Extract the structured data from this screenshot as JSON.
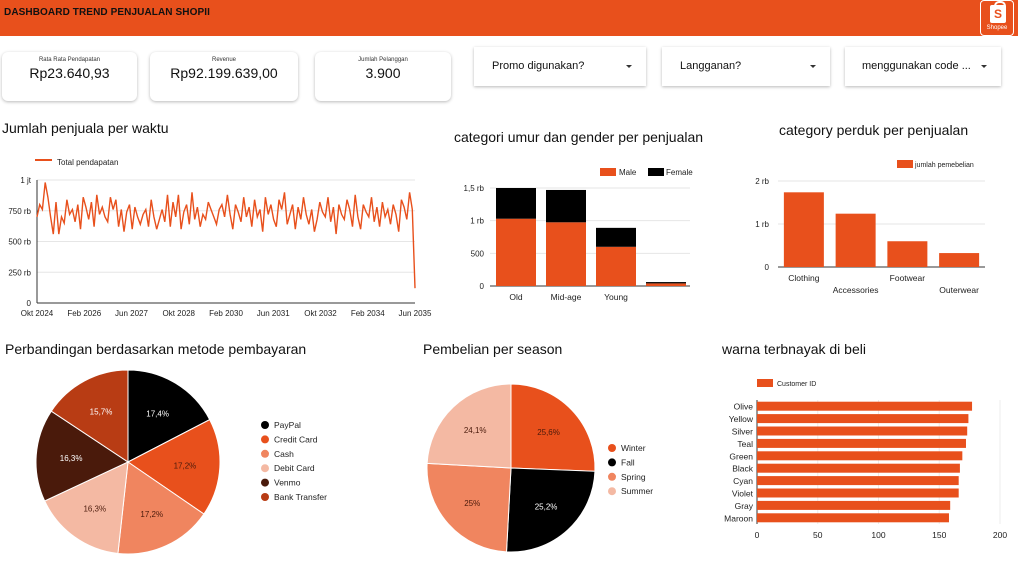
{
  "header": {
    "title": "DASHBOARD TREND PENJUALAN SHOPII",
    "logo_text": "S",
    "logo_label": "Shopee",
    "logo_icon": "shopee-bag-icon"
  },
  "kpis": [
    {
      "label": "Rata Rata Pendapatan",
      "value": "Rp23.640,93"
    },
    {
      "label": "Revenue",
      "value": "Rp92.199.639,00"
    },
    {
      "label": "Jumlah Pelanggan",
      "value": "3.900"
    }
  ],
  "filters": [
    {
      "label": "Promo digunakan?"
    },
    {
      "label": "Langganan?"
    },
    {
      "label": "menggunakan code ..."
    }
  ],
  "colors": {
    "accent": "#e8501c",
    "black": "#000000",
    "dark_brown": "#4a1a0b",
    "brown": "#b83c14",
    "salmon": "#f0855f",
    "light_salmon": "#f4b9a3"
  },
  "titles": {
    "line": "Jumlah penjuala per waktu",
    "stacked": "categori umur dan gender per penjualan",
    "category": "category perduk per penjualan",
    "payment": "Perbandingan berdasarkan metode pembayaran",
    "season": "Pembelian per season",
    "color": "warna terbnayak di beli"
  },
  "chart_data": [
    {
      "type": "line",
      "title": "Jumlah penjuala per waktu",
      "series": [
        {
          "name": "Total pendapatan",
          "values": [
            700,
            800,
            760,
            980,
            860,
            700,
            560,
            820,
            560,
            700,
            650,
            840,
            720,
            760,
            660,
            800,
            600,
            860,
            780,
            680,
            820,
            620,
            880,
            720,
            780,
            700,
            660,
            860,
            760,
            840,
            620,
            760,
            580,
            740,
            800,
            600,
            780,
            700,
            640,
            720,
            760,
            620,
            840,
            700,
            600,
            680,
            760,
            660,
            880,
            620,
            820,
            700,
            880,
            600,
            740,
            800,
            640,
            900,
            680,
            780,
            620,
            720,
            680,
            820,
            760,
            700,
            640,
            760,
            800,
            700,
            880,
            720,
            600,
            800,
            740,
            660,
            860,
            700,
            780,
            620,
            840,
            700,
            760,
            580,
            860,
            720,
            800,
            680,
            620,
            840,
            760,
            900,
            640,
            720,
            800,
            600,
            780,
            680,
            860,
            720,
            640,
            760,
            580,
            680,
            820,
            740,
            700,
            860,
            660,
            780,
            560,
            800,
            720,
            680,
            840,
            760,
            620,
            880,
            700,
            600,
            800,
            740,
            700,
            860,
            660,
            780,
            620,
            820,
            700,
            760,
            640,
            800,
            720,
            580,
            840,
            780,
            680,
            900,
            760,
            120
          ]
        }
      ],
      "x_ticks": [
        "Okt 2024",
        "Feb 2026",
        "Jun 2027",
        "Okt 2028",
        "Feb 2030",
        "Jun 2031",
        "Okt 2032",
        "Feb 2034",
        "Jun 2035"
      ],
      "y_ticks": [
        "0",
        "250 rb",
        "500 rb",
        "750 rb",
        "1 jt"
      ],
      "ylim": [
        0,
        1000000
      ],
      "legend": "top-left"
    },
    {
      "type": "bar",
      "stacked": true,
      "title": "categori umur dan gender per penjualan",
      "categories": [
        "Old",
        "Mid-age",
        "Young",
        ""
      ],
      "series": [
        {
          "name": "Male",
          "values": [
            1030,
            975,
            600,
            40
          ]
        },
        {
          "name": "Female",
          "values": [
            470,
            495,
            290,
            20
          ]
        }
      ],
      "y_ticks": [
        "0",
        "500",
        "1 rb",
        "1,5 rb"
      ],
      "ylim": [
        0,
        1500
      ],
      "legend": "top-right"
    },
    {
      "type": "bar",
      "title": "category perduk per penjualan",
      "categories": [
        "Clothing",
        "Accessories",
        "Footwear",
        "Outerwear"
      ],
      "series": [
        {
          "name": "jumlah pemebelian",
          "values": [
            1737,
            1240,
            599,
            324
          ]
        }
      ],
      "y_ticks": [
        "0",
        "1 rb",
        "2 rb"
      ],
      "ylim": [
        0,
        2000
      ],
      "legend": "top-right"
    },
    {
      "type": "pie",
      "title": "Perbandingan berdasarkan metode pembayaran",
      "categories": [
        "PayPal",
        "Credit Card",
        "Cash",
        "Debit Card",
        "Venmo",
        "Bank Transfer"
      ],
      "values": [
        17.4,
        17.2,
        17.2,
        16.3,
        16.3,
        15.7
      ],
      "labels": [
        "17,4%",
        "17,2%",
        "17,2%",
        "16,3%",
        "16,3%",
        "15,7%"
      ],
      "legend": "right"
    },
    {
      "type": "pie",
      "title": "Pembelian per season",
      "categories": [
        "Winter",
        "Fall",
        "Spring",
        "Summer"
      ],
      "values": [
        25.6,
        25.2,
        25,
        24.1
      ],
      "labels": [
        "25,6%",
        "25,2%",
        "25%",
        "24,1%"
      ],
      "legend": "right"
    },
    {
      "type": "bar",
      "orientation": "horizontal",
      "title": "warna terbnayak di beli",
      "categories": [
        "Olive",
        "Yellow",
        "Silver",
        "Teal",
        "Green",
        "Black",
        "Cyan",
        "Violet",
        "Gray",
        "Maroon"
      ],
      "series": [
        {
          "name": "Customer ID",
          "values": [
            177,
            174,
            173,
            172,
            169,
            167,
            166,
            166,
            159,
            158
          ]
        }
      ],
      "x_ticks": [
        "0",
        "50",
        "100",
        "150",
        "200"
      ],
      "xlim": [
        0,
        200
      ],
      "legend": "top-left"
    }
  ]
}
